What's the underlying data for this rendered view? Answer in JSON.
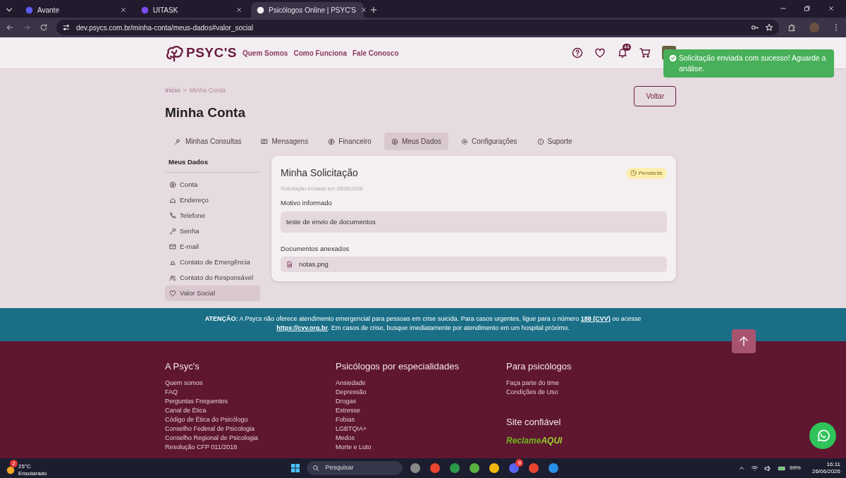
{
  "browser": {
    "tabs": [
      {
        "title": "Avante",
        "selected": false
      },
      {
        "title": "UITASK",
        "selected": false
      },
      {
        "title": "Psicólogos Online | PSYC'S",
        "selected": true
      }
    ],
    "url": "dev.psycs.com.br/minha-conta/meus-dados#valor_social"
  },
  "header": {
    "logo": "PSYC'S",
    "nav": [
      "Quem Somos",
      "Como Funciona",
      "Fale Conosco"
    ],
    "notification_count": "44"
  },
  "toast": {
    "text": "Solicitação enviada com sucesso! Aguarde a análise."
  },
  "breadcrumb": {
    "items": [
      "Início",
      "Minha Conta"
    ],
    "separator": ">"
  },
  "back_button": "Voltar",
  "title": "Minha Conta",
  "tabs": [
    {
      "label": "Minhas Consultas",
      "selected": false
    },
    {
      "label": "Mensagens",
      "selected": false
    },
    {
      "label": "Financeiro",
      "selected": false
    },
    {
      "label": "Meus Dados",
      "selected": true
    },
    {
      "label": "Configurações",
      "selected": false
    },
    {
      "label": "Suporte",
      "selected": false
    }
  ],
  "sidebar": {
    "title": "Meus Dados",
    "items": [
      {
        "label": "Conta",
        "selected": false
      },
      {
        "label": "Endereço",
        "selected": false
      },
      {
        "label": "Telefone",
        "selected": false
      },
      {
        "label": "Senha",
        "selected": false
      },
      {
        "label": "E-mail",
        "selected": false
      },
      {
        "label": "Contato de Emergência",
        "selected": false
      },
      {
        "label": "Contato do Responsável",
        "selected": false
      },
      {
        "label": "Valor Social",
        "selected": true
      }
    ]
  },
  "request": {
    "title": "Minha Solicitação",
    "status": "Pendente",
    "sent": "Solicitação enviada em 26/06/2026",
    "reason_label": "Motivo informado",
    "reason": "teste de envio de documentos",
    "documents_label": "Documentos anexados",
    "documents": [
      "notas.png"
    ]
  },
  "alert": [
    {
      "kind": "text",
      "text": "**ATENÇÃO:** A Psycs não oferece atendimento emergencial para pessoas em crise suicida. Para casos urgentes, ligue para o número "
    },
    {
      "kind": "link",
      "text": "188 (CVV)"
    },
    {
      "kind": "text",
      "text": " ou acesse "
    },
    {
      "kind": "link",
      "text": "https://cvv.org.br"
    },
    {
      "kind": "text",
      "text": ". Em casos de crise, busque imediatamente por atendimento em um hospital próximo."
    }
  ],
  "footer": {
    "columns": [
      {
        "title": "A Psyc's",
        "links": [
          "Quem somos",
          "FAQ",
          "Perguntas Frequentes",
          "Canal de Ética",
          "Código de Ética do Psicólogo",
          "Conselho Federal de Psicologia",
          "Conselho Regional de Psicologia",
          "Resolução CFP 011/2018"
        ]
      },
      {
        "title": "Psicólogos por especialidades",
        "links": [
          "Ansiedade",
          "Depressão",
          "Drogas",
          "Estresse",
          "Fobias",
          "LGBTQIA+",
          "Medos",
          "Morte e Luto"
        ]
      },
      {
        "title": "Para psicólogos",
        "links": [
          "Faça parte do time",
          "Condições de Uso"
        ]
      }
    ],
    "trust_title": "Site confiável",
    "trust_logo": [
      "Reclame",
      "AQUI"
    ]
  },
  "taskbar": {
    "weather_temp": "25°C",
    "weather_text": "Ensolarado",
    "weather_badge": "2",
    "search_placeholder": "Pesquisar",
    "chat_badge": "8",
    "battery": "99%",
    "time": "16:11",
    "date": "26/06/2026"
  }
}
